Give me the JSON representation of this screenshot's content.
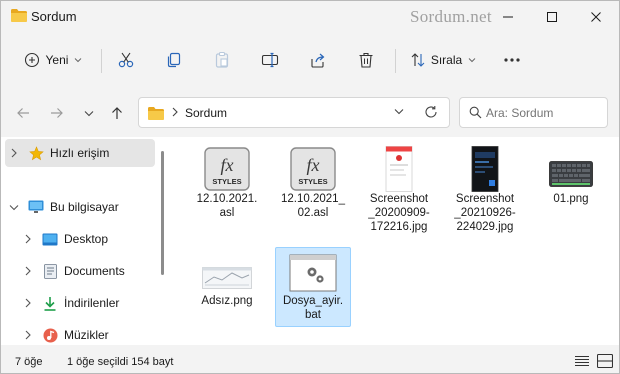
{
  "window": {
    "title": "Sordum",
    "watermark": "Sordum.net"
  },
  "toolbar": {
    "new_label": "Yeni",
    "sort_label": "Sırala"
  },
  "address": {
    "current": "Sordum"
  },
  "search": {
    "placeholder": "Ara: Sordum"
  },
  "sidebar": {
    "items": [
      {
        "label": "Hızlı erişim",
        "icon": "star-icon"
      },
      {
        "label": "Bu bilgisayar",
        "icon": "computer-icon"
      },
      {
        "label": "Desktop",
        "icon": "desktop-icon"
      },
      {
        "label": "Documents",
        "icon": "documents-icon"
      },
      {
        "label": "İndirilenler",
        "icon": "download-icon"
      },
      {
        "label": "Müzikler",
        "icon": "music-icon"
      }
    ]
  },
  "files": [
    {
      "name": "12.10.2021.\nasl",
      "type": "fx-styles",
      "badge": "STYLES"
    },
    {
      "name": "12.10.2021_\n02.asl",
      "type": "fx-styles",
      "badge": "STYLES"
    },
    {
      "name": "Screenshot\n_20200909-\n172216.jpg",
      "type": "phone-light"
    },
    {
      "name": "Screenshot\n_20210926-\n224029.jpg",
      "type": "phone-dark"
    },
    {
      "name": "01.png",
      "type": "keyboard"
    },
    {
      "name": "Adsız.png",
      "type": "wide-image"
    },
    {
      "name": "Dosya_ayir.\nbat",
      "type": "batch",
      "selected": true
    }
  ],
  "status": {
    "count": "7 öğe",
    "selection": "1 öğe seçildi  154 bayt"
  },
  "colors": {
    "accent": "#0067c0",
    "selection": "#cce8ff",
    "folder": "#f5c242"
  }
}
